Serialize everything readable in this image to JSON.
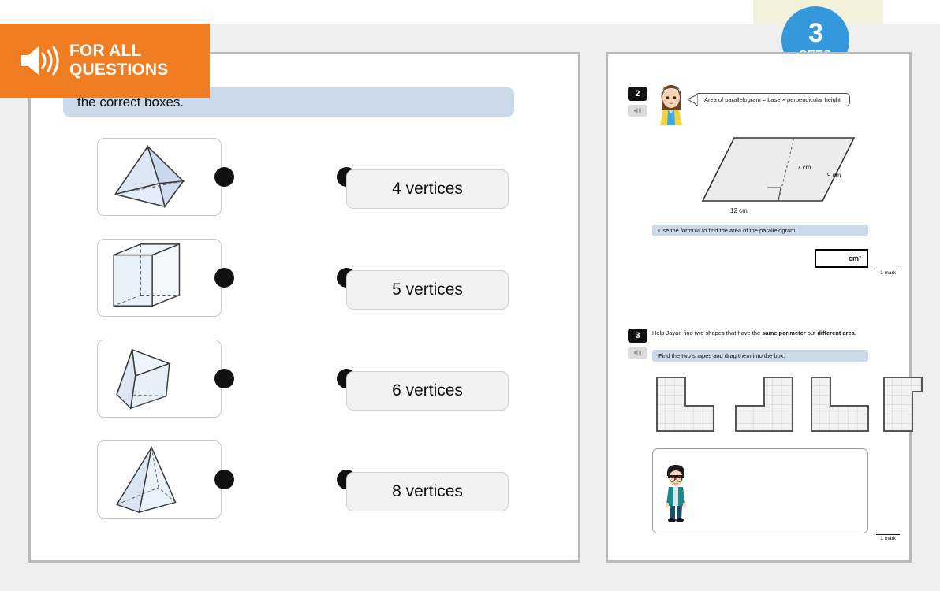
{
  "page": {
    "background_color": "#efefef",
    "top_strip_color": "#ffffff",
    "yellow_band_color": "#f2f1da"
  },
  "sets_badge": {
    "count": "3",
    "label": "SETS",
    "color": "#3498db"
  },
  "for_all_overlay": {
    "line1": "FOR ALL",
    "line2": "QUESTIONS",
    "icon": "speaker-icon",
    "color": "#f07d22"
  },
  "left_panel": {
    "question1": {
      "prompt": "the correct boxes.",
      "shapes": [
        {
          "name": "tetrahedron",
          "label": "triangular-based pyramid"
        },
        {
          "name": "cube",
          "label": "cube"
        },
        {
          "name": "triangular-prism",
          "label": "triangular prism"
        },
        {
          "name": "square-pyramid",
          "label": "square-based pyramid"
        }
      ],
      "options": [
        {
          "label": "4 vertices"
        },
        {
          "label": "5 vertices"
        },
        {
          "label": "6 vertices"
        },
        {
          "label": "8 vertices"
        }
      ]
    }
  },
  "right_panel": {
    "question2": {
      "number": "2",
      "speaker_icon": "speaker-icon",
      "character": "girl-avatar",
      "speech_bubble": "Area of parallelogram = base × perpendicular height",
      "diagram": {
        "type": "parallelogram",
        "height_label": "7 cm",
        "side_label": "9 cm",
        "base_label": "12 cm",
        "right_angle_marker": true
      },
      "instruction": "Use the formula to find the area of the parallelogram.",
      "answer_unit": "cm²",
      "answer_value": "",
      "mark": "1 mark"
    },
    "question3": {
      "number": "3",
      "speaker_icon": "speaker-icon",
      "text_part1": "Help Jayan find two shapes that have the ",
      "text_bold1": "same perimeter",
      "text_part2": " but ",
      "text_bold2": "different area",
      "text_part3": ".",
      "instruction": "Find the two shapes and drag them into the box.",
      "shapes": [
        {
          "name": "l-shape-wide-right"
        },
        {
          "name": "l-shape-mirrored"
        },
        {
          "name": "l-shape-narrow"
        },
        {
          "name": "notched-rectangle"
        }
      ],
      "character": "boy-avatar-jayan",
      "mark": "1 mark"
    }
  }
}
